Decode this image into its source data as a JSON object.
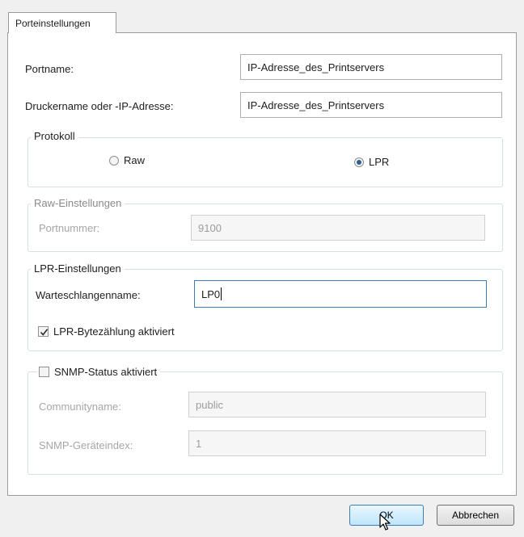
{
  "tab": {
    "label": "Porteinstellungen"
  },
  "portname": {
    "label": "Portname:",
    "value": "IP-Adresse_des_Printservers"
  },
  "printer": {
    "label": "Druckername oder -IP-Adresse:",
    "value": "IP-Adresse_des_Printservers"
  },
  "protocol": {
    "legend": "Protokoll",
    "raw_label": "Raw",
    "lpr_label": "LPR",
    "selected": "LPR"
  },
  "raw_settings": {
    "legend": "Raw-Einstellungen",
    "port_label": "Portnummer:",
    "port_value": "9100"
  },
  "lpr_settings": {
    "legend": "LPR-Einstellungen",
    "queue_label": "Warteschlangenname:",
    "queue_value": "LP0",
    "bytecount_label": "LPR-Bytezählung aktiviert",
    "bytecount_checked": true
  },
  "snmp": {
    "checkbox_label": "SNMP-Status aktiviert",
    "checked": false,
    "community_label": "Communityname:",
    "community_value": "public",
    "device_index_label": "SNMP-Geräteindex:",
    "device_index_value": "1"
  },
  "buttons": {
    "ok": "OK",
    "cancel": "Abbrechen"
  },
  "colors": {
    "accent": "#3c7fb1",
    "radio_dot": "#2d5f95",
    "disabled_text": "#a6a6a6"
  }
}
